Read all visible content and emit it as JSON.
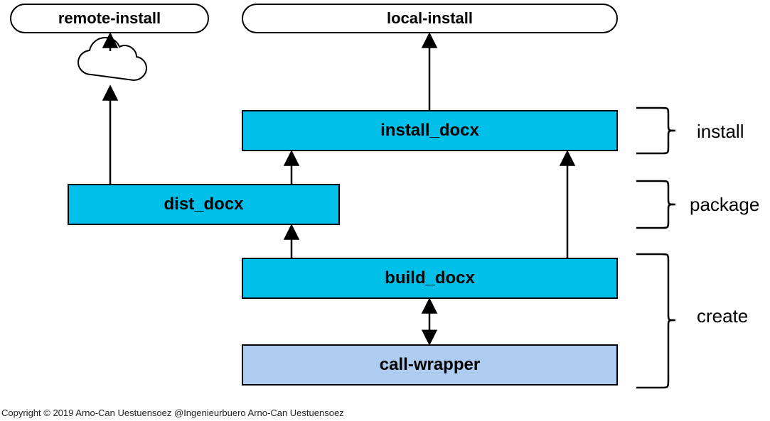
{
  "nodes": {
    "remote_install": "remote-install",
    "local_install": "local-install",
    "install_docx": "install_docx",
    "dist_docx": "dist_docx",
    "build_docx": "build_docx",
    "call_wrapper": "call-wrapper"
  },
  "phases": {
    "install": "install",
    "package": "package",
    "create": "create"
  },
  "copyright": "Copyright © 2019 Arno-Can Uestuensoez @Ingenieurbuero Arno-Can Uestuensoez"
}
